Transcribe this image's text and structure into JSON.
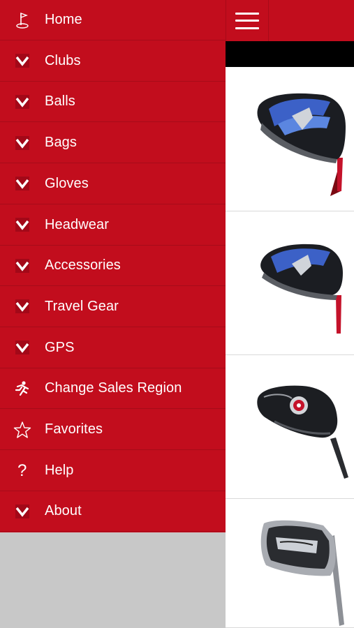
{
  "colors": {
    "accent": "#c20d1d",
    "divider": "#a70b19",
    "drawer_bottom": "#c8c8c8"
  },
  "menu": {
    "items": [
      {
        "label": "Home",
        "icon": "flag-icon"
      },
      {
        "label": "Clubs",
        "icon": "chevron-down-icon"
      },
      {
        "label": "Balls",
        "icon": "chevron-down-icon"
      },
      {
        "label": "Bags",
        "icon": "chevron-down-icon"
      },
      {
        "label": "Gloves",
        "icon": "chevron-down-icon"
      },
      {
        "label": "Headwear",
        "icon": "chevron-down-icon"
      },
      {
        "label": "Accessories",
        "icon": "chevron-down-icon"
      },
      {
        "label": "Travel Gear",
        "icon": "chevron-down-icon"
      },
      {
        "label": "GPS",
        "icon": "chevron-down-icon"
      },
      {
        "label": "Change Sales Region",
        "icon": "running-person-icon"
      },
      {
        "label": "Favorites",
        "icon": "star-icon"
      },
      {
        "label": "Help",
        "icon": "question-icon"
      },
      {
        "label": "About",
        "icon": "chevron-down-icon"
      }
    ]
  },
  "header": {
    "menu_button_icon": "hamburger-icon"
  },
  "products": [
    {
      "image": "driver-head-image"
    },
    {
      "image": "fairway-wood-head-image"
    },
    {
      "image": "hybrid-head-image"
    },
    {
      "image": "iron-head-image"
    }
  ]
}
